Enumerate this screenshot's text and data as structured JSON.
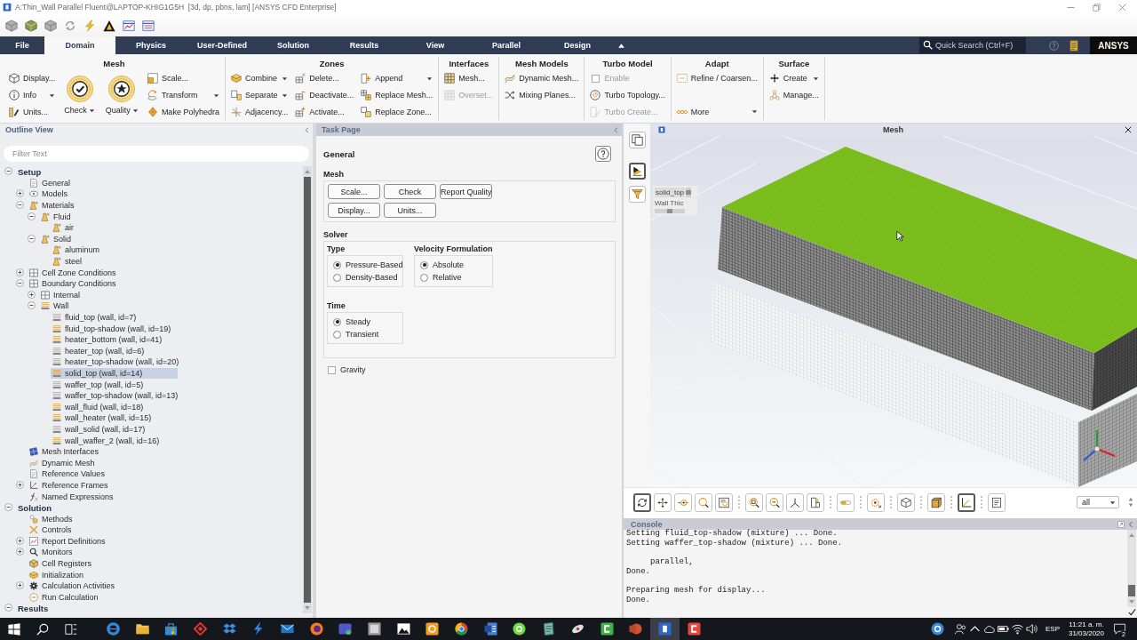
{
  "window": {
    "title": "A:Thin_Wall Parallel Fluent@LAPTOP-KHIG1G5H  [3d, dp, pbns, lam] [ANSYS CFD Enterprise]"
  },
  "ribbon": {
    "tabs": [
      {
        "label": "File",
        "selected": false
      },
      {
        "label": "Domain",
        "selected": true
      },
      {
        "label": "Physics",
        "selected": false
      },
      {
        "label": "User-Defined",
        "selected": false
      },
      {
        "label": "Solution",
        "selected": false
      },
      {
        "label": "Results",
        "selected": false
      },
      {
        "label": "View",
        "selected": false
      },
      {
        "label": "Parallel",
        "selected": false
      },
      {
        "label": "Design",
        "selected": false
      }
    ],
    "search": {
      "placeholder": "Quick Search (Ctrl+F)"
    },
    "logo": "ANSYS",
    "groups": [
      {
        "title": "Mesh",
        "columns": [
          [
            {
              "label": "Display...",
              "kind": "small",
              "dropdown": false,
              "disabled": false
            },
            {
              "label": "Info",
              "kind": "small",
              "dropdown": true,
              "disabled": false
            },
            {
              "label": "Units...",
              "kind": "small",
              "dropdown": false,
              "disabled": false
            }
          ],
          [
            {
              "label": "Check",
              "kind": "large",
              "dropdown": true,
              "disabled": false
            }
          ],
          [
            {
              "label": "Quality",
              "kind": "large",
              "dropdown": true,
              "disabled": false
            }
          ],
          [
            {
              "label": "Scale...",
              "kind": "small",
              "dropdown": false,
              "disabled": false
            },
            {
              "label": "Transform",
              "kind": "small",
              "dropdown": true,
              "disabled": false
            },
            {
              "label": "Make Polyhedra",
              "kind": "small",
              "dropdown": false,
              "disabled": false
            }
          ]
        ]
      },
      {
        "title": "Zones",
        "columns": [
          [
            {
              "label": "Combine",
              "kind": "small",
              "dropdown": true,
              "disabled": false
            },
            {
              "label": "Separate",
              "kind": "small",
              "dropdown": true,
              "disabled": false
            },
            {
              "label": "Adjacency...",
              "kind": "small",
              "dropdown": false,
              "disabled": false
            }
          ],
          [
            {
              "label": "Delete...",
              "kind": "small",
              "dropdown": false,
              "disabled": false
            },
            {
              "label": "Deactivate...",
              "kind": "small",
              "dropdown": false,
              "disabled": false
            },
            {
              "label": "Activate...",
              "kind": "small",
              "dropdown": false,
              "disabled": false
            }
          ],
          [
            {
              "label": "Append",
              "kind": "small",
              "dropdown": true,
              "disabled": false
            },
            {
              "label": "Replace Mesh...",
              "kind": "small",
              "dropdown": false,
              "disabled": false
            },
            {
              "label": "Replace Zone...",
              "kind": "small",
              "dropdown": false,
              "disabled": false
            }
          ]
        ]
      },
      {
        "title": "Interfaces",
        "columns": [
          [
            {
              "label": "Mesh...",
              "kind": "small",
              "dropdown": false,
              "disabled": false
            },
            {
              "label": "Overset...",
              "kind": "small",
              "dropdown": false,
              "disabled": true
            }
          ]
        ]
      },
      {
        "title": "Mesh Models",
        "columns": [
          [
            {
              "label": "Dynamic Mesh...",
              "kind": "small",
              "dropdown": false,
              "disabled": false
            },
            {
              "label": "Mixing Planes...",
              "kind": "small",
              "dropdown": false,
              "disabled": false
            }
          ]
        ]
      },
      {
        "title": "Turbo Model",
        "columns": [
          [
            {
              "label": "Enable",
              "kind": "checkbox",
              "checked": false,
              "disabled": true
            },
            {
              "label": "Turbo Topology...",
              "kind": "small",
              "dropdown": false,
              "disabled": false
            },
            {
              "label": "Turbo Create...",
              "kind": "small",
              "dropdown": false,
              "disabled": true
            }
          ]
        ]
      },
      {
        "title": "Adapt",
        "columns": [
          [
            {
              "label": "Refine / Coarsen...",
              "kind": "small",
              "dropdown": false,
              "disabled": false
            },
            {
              "label": "More",
              "kind": "more",
              "dropdown": true,
              "disabled": false
            }
          ]
        ]
      },
      {
        "title": "Surface",
        "columns": [
          [
            {
              "label": "Create",
              "kind": "small",
              "dropdown": true,
              "disabled": false
            },
            {
              "label": "Manage...",
              "kind": "small",
              "dropdown": false,
              "disabled": false
            }
          ]
        ]
      }
    ]
  },
  "outline": {
    "title": "Outline View",
    "filter": {
      "placeholder": "Filter Text"
    },
    "tree": [
      {
        "label": "Setup",
        "kind": "section",
        "expanded": true,
        "selected": false,
        "children": [
          {
            "label": "General",
            "kind": "page",
            "selected": false
          },
          {
            "label": "Models",
            "kind": "model",
            "expanded": false,
            "selected": false
          },
          {
            "label": "Materials",
            "kind": "material",
            "expanded": true,
            "selected": false,
            "children": [
              {
                "label": "Fluid",
                "kind": "material",
                "expanded": true,
                "selected": false,
                "children": [
                  {
                    "label": "air",
                    "kind": "material",
                    "selected": false
                  }
                ]
              },
              {
                "label": "Solid",
                "kind": "material",
                "expanded": true,
                "selected": false,
                "children": [
                  {
                    "label": "aluminum",
                    "kind": "material",
                    "selected": false
                  },
                  {
                    "label": "steel",
                    "kind": "material",
                    "selected": false
                  }
                ]
              }
            ]
          },
          {
            "label": "Cell Zone Conditions",
            "kind": "zone",
            "expanded": false,
            "selected": false
          },
          {
            "label": "Boundary Conditions",
            "kind": "zone",
            "expanded": true,
            "selected": false,
            "children": [
              {
                "label": "Internal",
                "kind": "zone",
                "expanded": false,
                "selected": false
              },
              {
                "label": "Wall",
                "kind": "wall",
                "expanded": true,
                "selected": false,
                "children": [
                  {
                    "label": "fluid_top (wall, id=7)",
                    "kind": "wall",
                    "selected": false
                  },
                  {
                    "label": "fluid_top-shadow (wall, id=19)",
                    "kind": "wall",
                    "selected": false
                  },
                  {
                    "label": "heater_bottom (wall, id=41)",
                    "kind": "wall",
                    "selected": false
                  },
                  {
                    "label": "heater_top (wall, id=6)",
                    "kind": "wall",
                    "selected": false
                  },
                  {
                    "label": "heater_top-shadow (wall, id=20)",
                    "kind": "wall",
                    "selected": false
                  },
                  {
                    "label": "solid_top (wall, id=14)",
                    "kind": "wall",
                    "selected": true
                  },
                  {
                    "label": "waffer_top (wall, id=5)",
                    "kind": "wall",
                    "selected": false
                  },
                  {
                    "label": "waffer_top-shadow (wall, id=13)",
                    "kind": "wall",
                    "selected": false
                  },
                  {
                    "label": "wall_fluid (wall, id=18)",
                    "kind": "wall",
                    "selected": false
                  },
                  {
                    "label": "wall_heater (wall, id=15)",
                    "kind": "wall",
                    "selected": false
                  },
                  {
                    "label": "wall_solid (wall, id=17)",
                    "kind": "wall",
                    "selected": false
                  },
                  {
                    "label": "wall_waffer_2 (wall, id=16)",
                    "kind": "wall",
                    "selected": false
                  }
                ]
              }
            ]
          },
          {
            "label": "Mesh Interfaces",
            "kind": "interface",
            "selected": false
          },
          {
            "label": "Dynamic Mesh",
            "kind": "dynamic",
            "selected": false
          },
          {
            "label": "Reference Values",
            "kind": "page",
            "selected": false
          },
          {
            "label": "Reference Frames",
            "kind": "axes",
            "expanded": false,
            "selected": false
          },
          {
            "label": "Named Expressions",
            "kind": "expression",
            "selected": false
          }
        ]
      },
      {
        "label": "Solution",
        "kind": "section",
        "expanded": true,
        "selected": false,
        "children": [
          {
            "label": "Methods",
            "kind": "method",
            "selected": false
          },
          {
            "label": "Controls",
            "kind": "control",
            "selected": false
          },
          {
            "label": "Report Definitions",
            "kind": "report",
            "expanded": false,
            "selected": false
          },
          {
            "label": "Monitors",
            "kind": "monitor",
            "expanded": false,
            "selected": false
          },
          {
            "label": "Cell Registers",
            "kind": "register",
            "selected": false
          },
          {
            "label": "Initialization",
            "kind": "init",
            "selected": false
          },
          {
            "label": "Calculation Activities",
            "kind": "gear",
            "expanded": false,
            "selected": false
          },
          {
            "label": "Run Calculation",
            "kind": "run",
            "selected": false
          }
        ]
      },
      {
        "label": "Results",
        "kind": "section",
        "expanded": true,
        "selected": false
      }
    ]
  },
  "task_page": {
    "title": "Task Page",
    "heading": "General",
    "mesh": {
      "title": "Mesh",
      "buttons": [
        "Scale...",
        "Check",
        "Report Quality",
        "Display...",
        "Units..."
      ]
    },
    "solver": {
      "title": "Solver",
      "groups": [
        {
          "title": "Type",
          "options": [
            {
              "label": "Pressure-Based",
              "selected": true
            },
            {
              "label": "Density-Based",
              "selected": false
            }
          ]
        },
        {
          "title": "Velocity Formulation",
          "options": [
            {
              "label": "Absolute",
              "selected": true
            },
            {
              "label": "Relative",
              "selected": false
            }
          ]
        },
        {
          "title": "Time",
          "options": [
            {
              "label": "Steady",
              "selected": true
            },
            {
              "label": "Transient",
              "selected": false
            }
          ]
        }
      ]
    },
    "gravity": {
      "label": "Gravity",
      "checked": false
    }
  },
  "graphics": {
    "side_tools": [
      {
        "selected": false
      },
      {
        "selected": true
      },
      {
        "selected": false
      }
    ],
    "title": "Mesh",
    "legend": {
      "zone": "solid_top",
      "label": "Wall Thic"
    },
    "toolbar": [
      {
        "selected": true
      },
      {
        "selected": false
      },
      {
        "selected": false
      },
      {
        "selected": false
      },
      {
        "selected": false
      },
      {
        "selected": false
      },
      {
        "selected": false
      },
      {
        "selected": false
      },
      {
        "selected": false
      },
      {
        "selected": false
      },
      {
        "selected": false
      },
      {
        "selected": false
      },
      {
        "selected": false
      },
      {
        "selected": true
      },
      {
        "selected": false
      }
    ],
    "view_filter": "all"
  },
  "console": {
    "title": "Console",
    "blocks": [
      [
        "Setting fluid_top-shadow (mixture) ... Done.",
        "Setting waffer_top-shadow (mixture) ... Done."
      ],
      [
        "     parallel,",
        "Done."
      ],
      [
        "Preparing mesh for display...",
        "Done."
      ]
    ]
  },
  "taskbar": {
    "apps": [
      {
        "selected": false
      },
      {
        "selected": false
      },
      {
        "selected": false
      },
      {
        "selected": false
      },
      {
        "selected": false
      },
      {
        "selected": false
      },
      {
        "selected": false
      },
      {
        "selected": false
      },
      {
        "selected": false
      },
      {
        "selected": false
      },
      {
        "selected": false
      },
      {
        "selected": false
      },
      {
        "selected": false
      },
      {
        "selected": false
      },
      {
        "selected": false
      },
      {
        "selected": false
      },
      {
        "selected": false
      },
      {
        "selected": false
      },
      {
        "selected": false
      },
      {
        "selected": true
      },
      {
        "selected": false
      }
    ],
    "language": "ESP",
    "time": "11:21 a. m.",
    "date": "31/03/2020",
    "notifications": "2"
  }
}
